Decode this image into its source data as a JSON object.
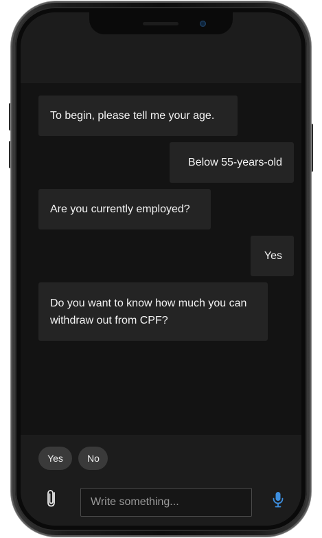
{
  "chat": {
    "messages": [
      {
        "sender": "bot",
        "text": "To begin, please tell me your age."
      },
      {
        "sender": "user",
        "text": "Below 55-years-old"
      },
      {
        "sender": "bot",
        "text": "Are you currently employed?"
      },
      {
        "sender": "user",
        "text": "Yes"
      },
      {
        "sender": "bot",
        "text": "Do you want to know how much you can withdraw out from CPF?"
      }
    ]
  },
  "quick_replies": [
    "Yes",
    "No"
  ],
  "composer": {
    "placeholder": "Write something...",
    "attach_icon": "paperclip-icon",
    "mic_icon": "microphone-icon"
  },
  "colors": {
    "accent": "#3d8fe0",
    "bubble": "#242424",
    "screen": "#131313"
  }
}
